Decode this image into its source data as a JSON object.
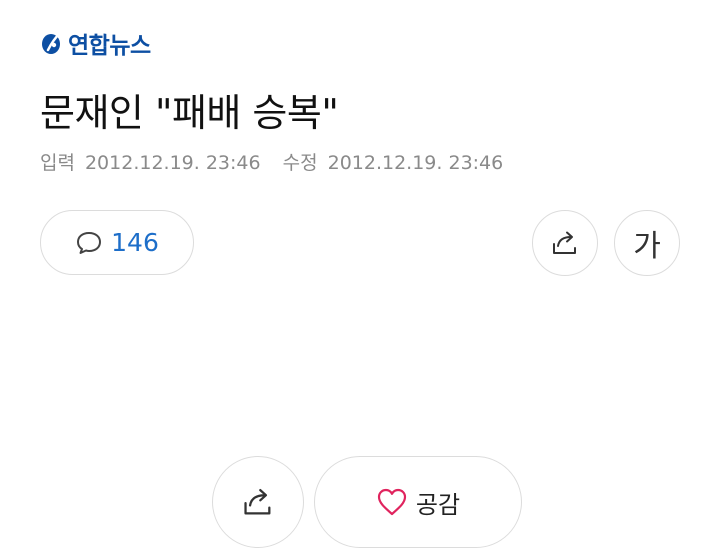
{
  "header": {
    "logo_text": "연합뉴스",
    "logo_icon": "yonhap-logo-mark",
    "brand_color": "#0d4fa3"
  },
  "article": {
    "title": "문재인 \"패배 승복\"",
    "entered_label": "입력",
    "entered_time": "2012.12.19. 23:46",
    "modified_label": "수정",
    "modified_time": "2012.12.19. 23:46"
  },
  "toolbar": {
    "comment_icon": "speech-bubble-icon",
    "comment_count": "146",
    "comment_color": "#1d6ec9",
    "share_icon": "share-arrow-icon",
    "font_size_label": "가"
  },
  "footer": {
    "share_icon": "share-arrow-icon",
    "like_icon": "heart-icon",
    "like_label": "공감",
    "like_color": "#e0245e"
  }
}
